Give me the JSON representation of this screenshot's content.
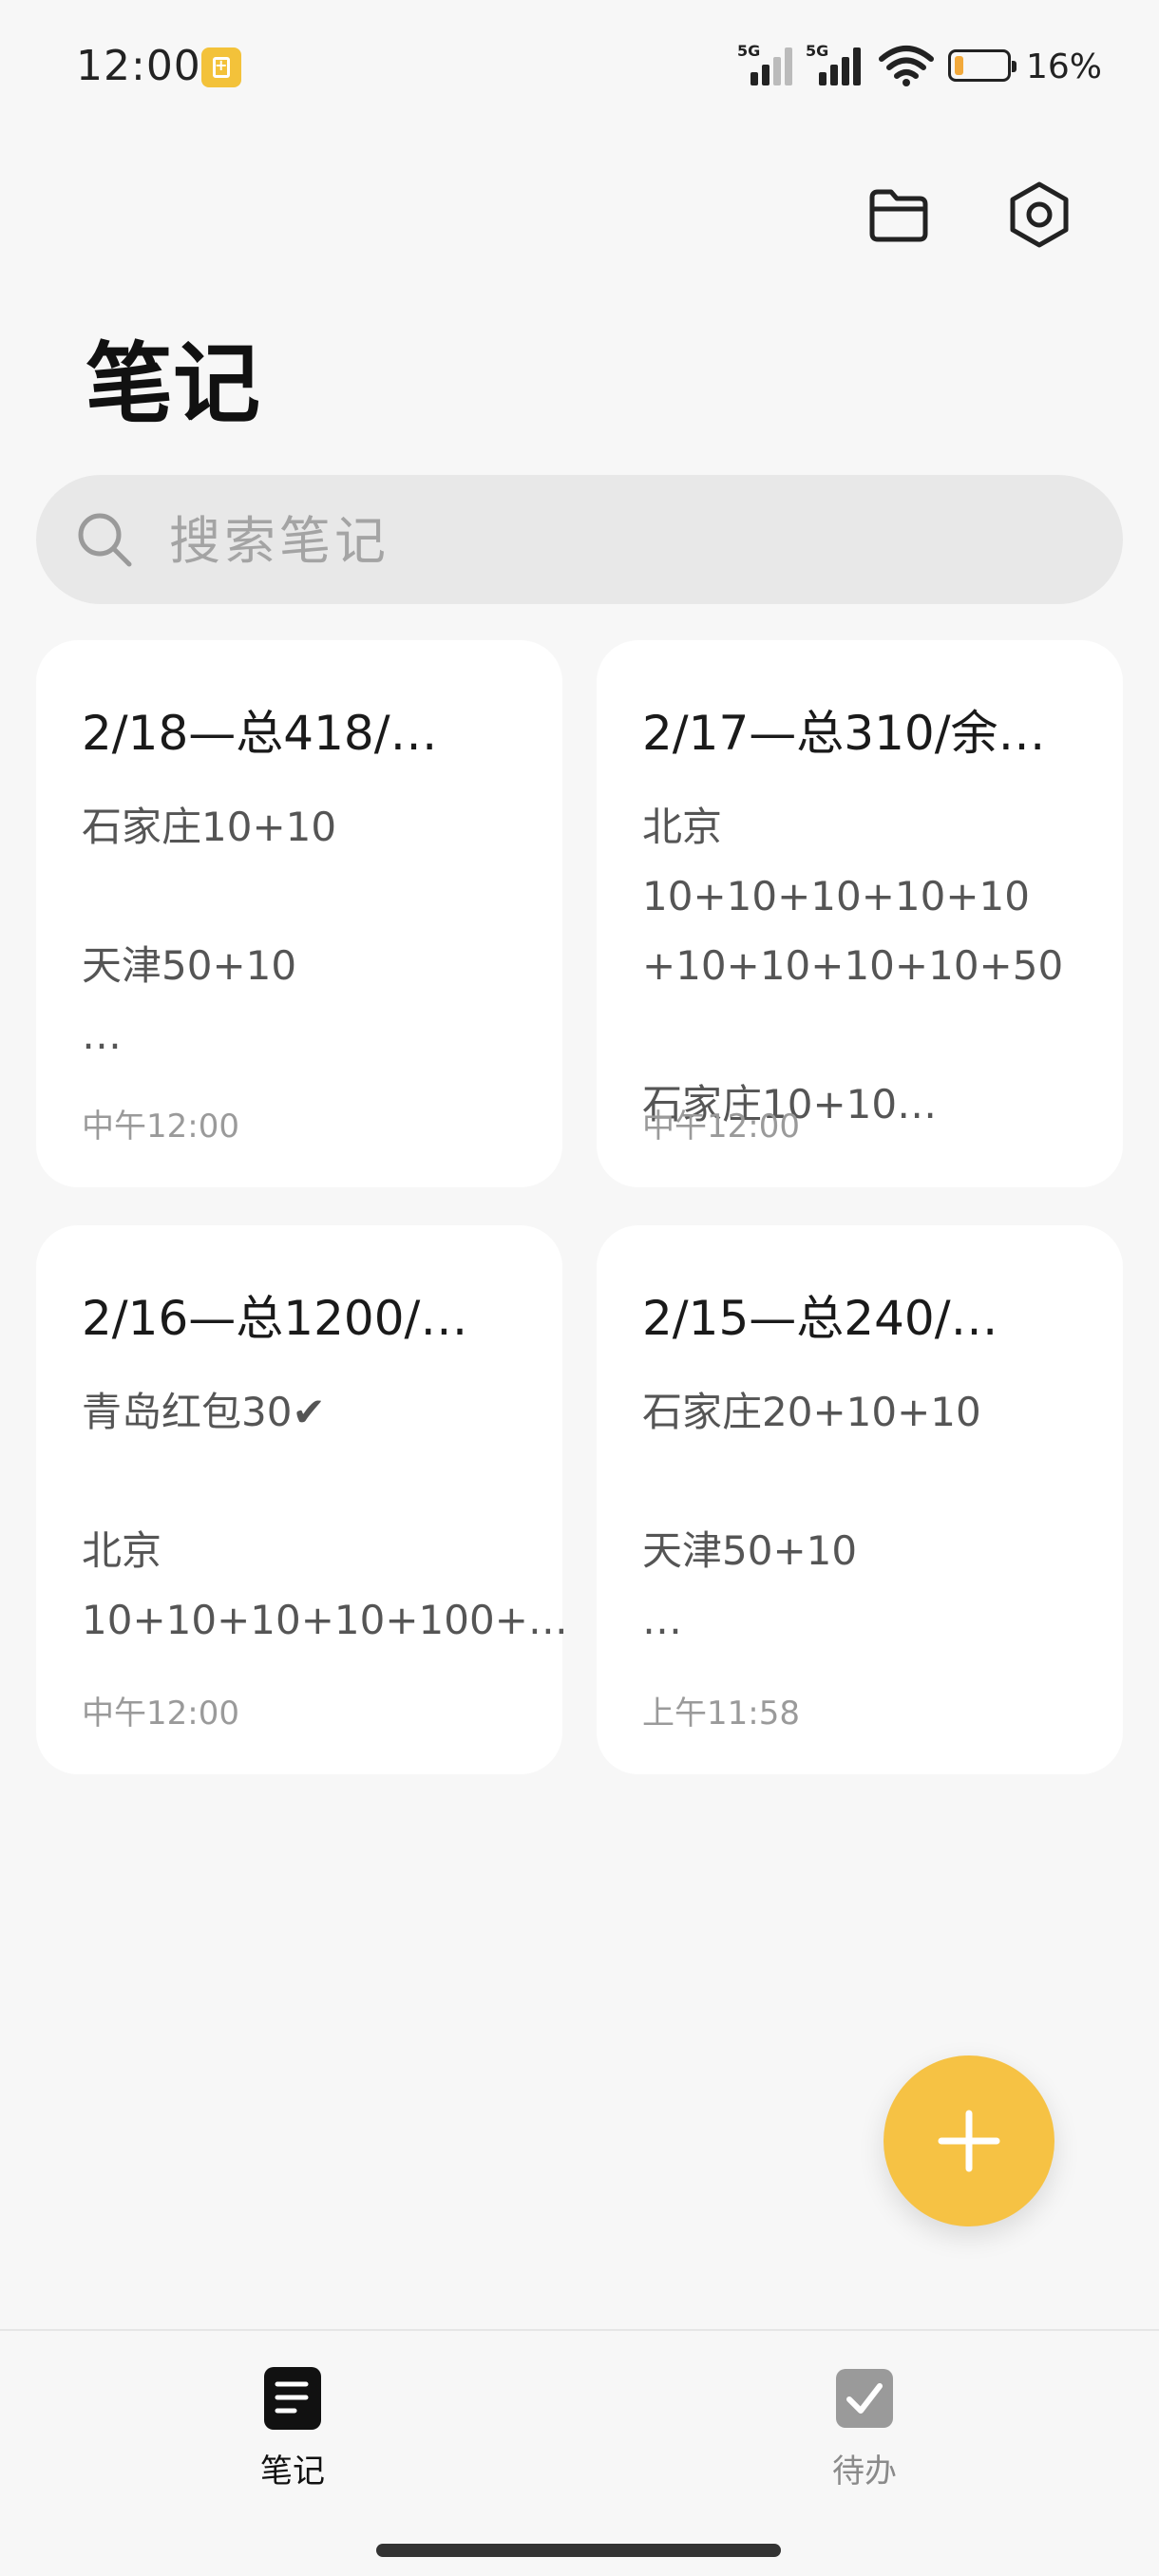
{
  "status_bar": {
    "time": "12:00",
    "signal_1_label": "5G",
    "signal_2_label": "5G",
    "battery_percent": 16,
    "battery_text": "16%",
    "battery_color": "#f2a93b"
  },
  "header": {
    "title": "笔记",
    "folder_icon": "folder-icon",
    "settings_icon": "settings-icon"
  },
  "search": {
    "placeholder": "搜索笔记",
    "value": ""
  },
  "notes": [
    {
      "title": "2/18—总418/…",
      "body": "石家庄10+10\n\n天津50+10\n…",
      "time": "中午12:00"
    },
    {
      "title": "2/17—总310/余…",
      "body": "北京10+10+10+10+10\n+10+10+10+10+50\n\n石家庄10+10…",
      "time": "中午12:00"
    },
    {
      "title": "2/16—总1200/…",
      "body": "青岛红包30✔\n\n北京\n10+10+10+10+100+…",
      "time": "中午12:00"
    },
    {
      "title": "2/15—总240/…",
      "body": "石家庄20+10+10\n\n天津50+10\n…",
      "time": "上午11:58"
    }
  ],
  "fab": {
    "icon": "plus-icon",
    "color": "#f6c244"
  },
  "bottom_nav": {
    "items": [
      {
        "label": "笔记",
        "icon": "note-icon",
        "active": true
      },
      {
        "label": "待办",
        "icon": "todo-check-icon",
        "active": false
      }
    ]
  }
}
